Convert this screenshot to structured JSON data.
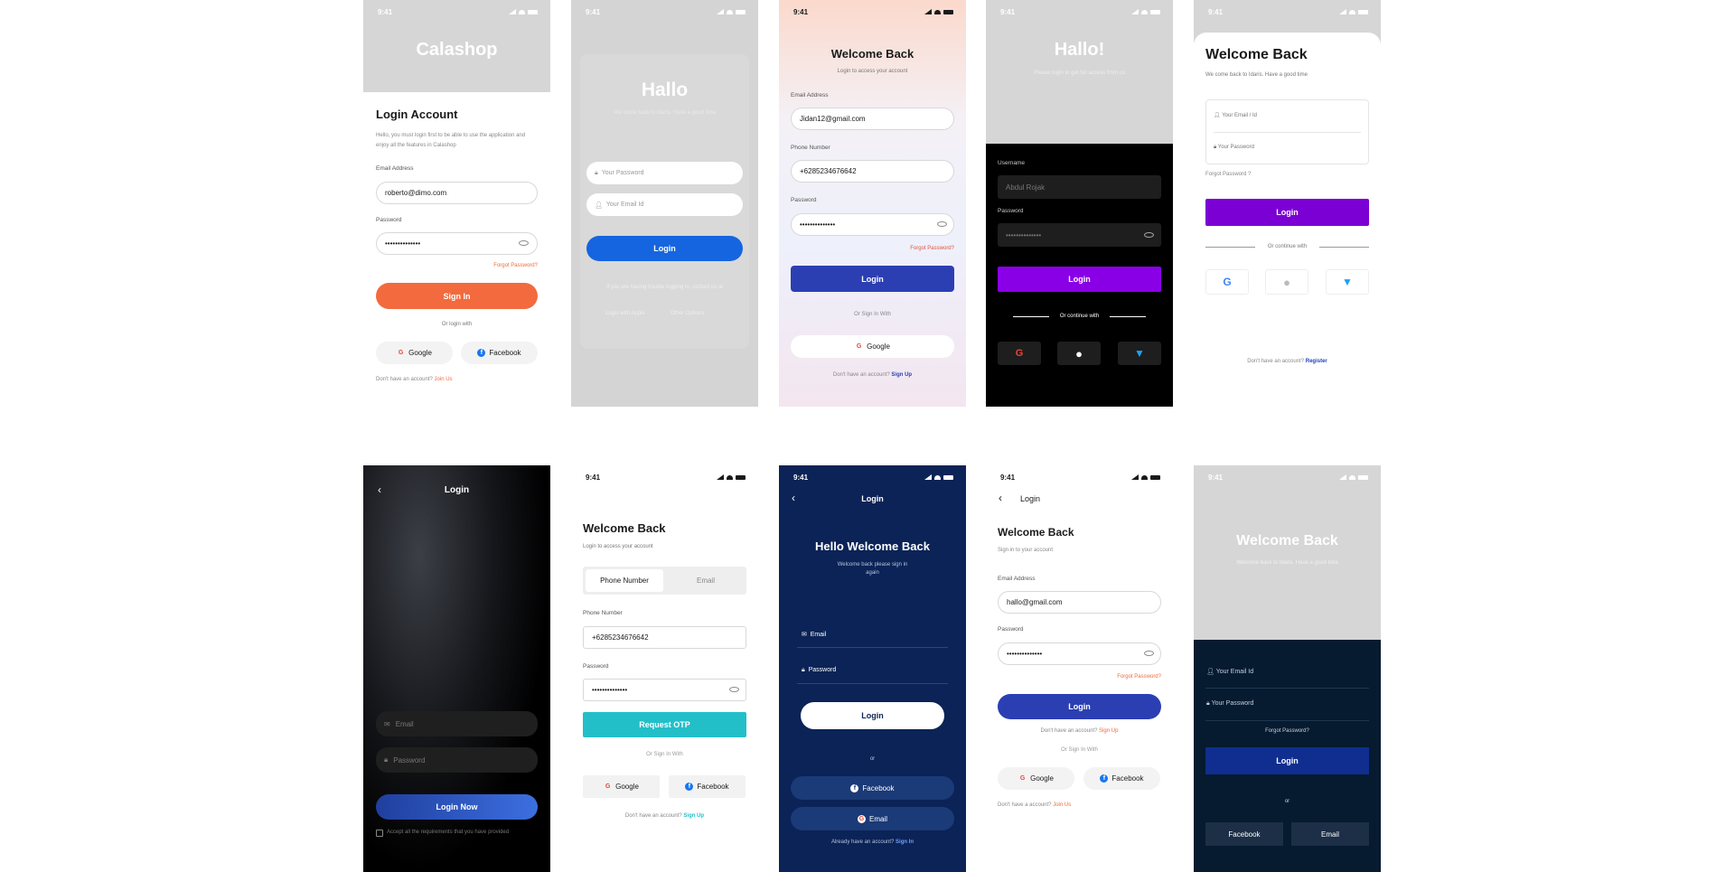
{
  "status_time": "9:41",
  "screen1": {
    "brand": "Calashop",
    "title": "Login Account",
    "desc": "Hello, you must login first to be able to use the application and enjoy all the features in Calashop",
    "email_label": "Email Address",
    "email_value": "roberto@dimo.com",
    "password_label": "Password",
    "password_value": "••••••••••••••",
    "forgot": "Forgot Password?",
    "signin": "Sign In",
    "or": "Or login with",
    "google": "Google",
    "facebook": "Facebook",
    "footer": "Don't have an account?",
    "footer_link": "Join Us",
    "accent": "#f26a3d"
  },
  "screen2": {
    "title": "Hallo",
    "subtitle": "We come back to Idaris. Have a good time",
    "password_ph": "Your Password",
    "email_ph": "Your Email Id",
    "login": "Login",
    "footer": "If you are having trouble logging in, contact us at",
    "link1": "Login with Apple",
    "link2": "Other Options",
    "accent": "#1565e0"
  },
  "screen3": {
    "title": "Welcome Back",
    "subtitle": "Login to access your account",
    "email_label": "Email Address",
    "email_value": "Jidan12@gmail.com",
    "phone_label": "Phone Number",
    "phone_value": "+6285234676642",
    "password_label": "Password",
    "password_value": "••••••••••••••",
    "forgot": "Forgot Password?",
    "login": "Login",
    "or": "Or Sign In With",
    "google": "Google",
    "footer": "Don't have an account?",
    "footer_link": "Sign Up",
    "accent": "#2b3fb3"
  },
  "screen4": {
    "title": "Hallo!",
    "subtitle": "Please login to get full access from us",
    "username_label": "Username",
    "username_value": "Abdul Rojak",
    "password_label": "Password",
    "password_value": "••••••••••••••",
    "login": "Login",
    "or": "Or continue with",
    "accent": "#8a00e6"
  },
  "screen5": {
    "title": "Welcome Back",
    "subtitle": "We come back to Idaris. Have a good time",
    "email_ph": "Your Email / Id",
    "password_ph": "Your Password",
    "forgot": "Forgot Password ?",
    "login": "Login",
    "or": "Or continue with",
    "footer": "Don't have an account?",
    "footer_link": "Register",
    "accent": "#7b00d4"
  },
  "screen6": {
    "title": "Login",
    "email_ph": "Email",
    "password_ph": "Password",
    "login": "Login Now",
    "terms": "Accept all the requirements that you have provided",
    "accent": "#2b55c8"
  },
  "screen7": {
    "title": "Welcome Back",
    "subtitle": "Login to access your account",
    "tab1": "Phone Number",
    "tab2": "Email",
    "phone_label": "Phone Number",
    "phone_value": "+6285234676642",
    "password_label": "Password",
    "password_value": "••••••••••••••",
    "otp": "Request OTP",
    "or": "Or Sign In With",
    "google": "Google",
    "facebook": "Facebook",
    "footer": "Don't have an account?",
    "footer_link": "Sign Up",
    "accent": "#22bfc9"
  },
  "screen8": {
    "header": "Login",
    "title": "Hello Welcome Back",
    "subtitle": "Welcome back please sign in again",
    "email_ph": "Email",
    "password_ph": "Password",
    "login": "Login",
    "or": "or",
    "facebook": "Facebook",
    "email_btn": "Email",
    "footer": "Already have an account?",
    "footer_link": "Sign In",
    "bg": "#0b2356"
  },
  "screen9": {
    "header": "Login",
    "title": "Welcome Back",
    "subtitle": "Sign in to your account",
    "email_label": "Email Address",
    "email_value": "hallo@gmail.com",
    "password_label": "Password",
    "password_value": "••••••••••••••",
    "forgot": "Forgot Password?",
    "login": "Login",
    "signup_q": "Don't have an account?",
    "signup_link": "Sign Up",
    "or": "Or Sign In With",
    "google": "Google",
    "facebook": "Facebook",
    "footer": "Don't have a account?",
    "footer_link": "Join Us",
    "accent": "#2b3fb3"
  },
  "screen10": {
    "title": "Welcome Back",
    "subtitle": "Welcome back to Idaris. Have a good time",
    "email_ph": "Your Email Id",
    "password_ph": "Your Password",
    "forgot": "Forgot Password?",
    "login": "Login",
    "or": "or",
    "facebook": "Facebook",
    "email_btn": "Email",
    "bg": "#061a30",
    "accent": "#0f2e8f"
  }
}
